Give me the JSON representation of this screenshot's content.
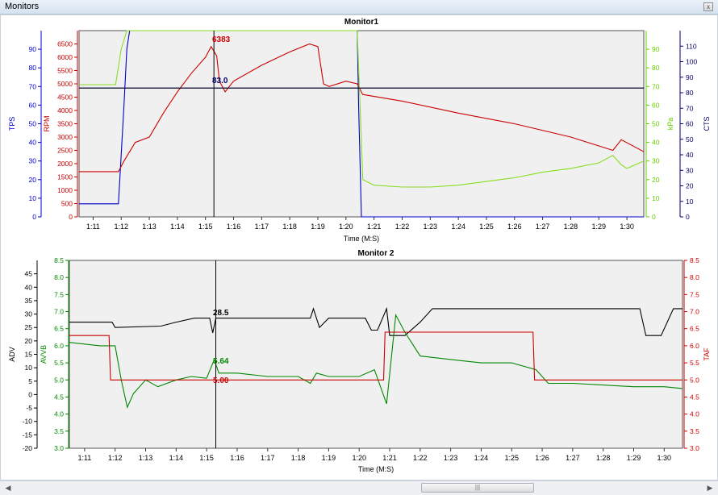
{
  "window": {
    "title": "Monitors",
    "close_glyph": "x"
  },
  "scrollbar": {
    "left_icon": "arrow-left-icon",
    "right_icon": "arrow-right-icon",
    "thumb_grip": "|||"
  },
  "chart_data": [
    {
      "type": "line",
      "title": "Monitor1",
      "xlabel": "Time (M:S)",
      "x_ticks": [
        "1:11",
        "1:12",
        "1:13",
        "1:14",
        "1:15",
        "1:16",
        "1:17",
        "1:18",
        "1:19",
        "1:20",
        "1:21",
        "1:22",
        "1:23",
        "1:24",
        "1:25",
        "1:26",
        "1:27",
        "1:28",
        "1:29",
        "1:30"
      ],
      "xlim": [
        "1:10.5",
        "1:30.6"
      ],
      "cursor": {
        "x": "1:15.3"
      },
      "axes": [
        {
          "id": "tps",
          "label": "TPS",
          "side": "left-outer",
          "color": "#0000cc",
          "range": [
            0,
            100
          ],
          "ticks": [
            0,
            10,
            20,
            30,
            40,
            50,
            60,
            70,
            80,
            90
          ]
        },
        {
          "id": "rpm",
          "label": "RPM",
          "side": "left-inner",
          "color": "#cc0000",
          "range": [
            0,
            7000
          ],
          "ticks": [
            0,
            500,
            1000,
            1500,
            2000,
            2500,
            3000,
            3500,
            4000,
            4500,
            5000,
            5500,
            6000,
            6500
          ]
        },
        {
          "id": "kpa",
          "label": "kPa",
          "side": "right-inner",
          "color": "#66cc00",
          "range": [
            0,
            100
          ],
          "ticks": [
            0,
            10,
            20,
            30,
            40,
            50,
            60,
            70,
            80,
            90
          ]
        },
        {
          "id": "cts",
          "label": "CTS",
          "side": "right-outer",
          "color": "#000066",
          "range": [
            0,
            120
          ],
          "ticks": [
            0,
            10,
            20,
            30,
            40,
            50,
            60,
            70,
            80,
            90,
            100,
            110
          ]
        }
      ],
      "series": [
        {
          "axis": "tps",
          "color": "#0000cc",
          "points": [
            [
              "1:10.5",
              7
            ],
            [
              "1:11.9",
              7
            ],
            [
              "1:12.1",
              60
            ],
            [
              "1:12.2",
              90
            ],
            [
              "1:12.3",
              100
            ],
            [
              "1:20.4",
              100
            ],
            [
              "1:20.45",
              60
            ],
            [
              "1:20.55",
              0
            ],
            [
              "1:30.6",
              0
            ]
          ]
        },
        {
          "axis": "rpm",
          "color": "#cc0000",
          "points": [
            [
              "1:10.5",
              1700
            ],
            [
              "1:11.9",
              1700
            ],
            [
              "1:12.1",
              2100
            ],
            [
              "1:12.5",
              2800
            ],
            [
              "1:13.0",
              3000
            ],
            [
              "1:13.5",
              3900
            ],
            [
              "1:14.0",
              4700
            ],
            [
              "1:14.5",
              5400
            ],
            [
              "1:15.0",
              6000
            ],
            [
              "1:15.2",
              6400
            ],
            [
              "1:15.4",
              6050
            ],
            [
              "1:15.5",
              5100
            ],
            [
              "1:15.7",
              4700
            ],
            [
              "1:16.0",
              5100
            ],
            [
              "1:17.0",
              5700
            ],
            [
              "1:18.0",
              6200
            ],
            [
              "1:18.7",
              6500
            ],
            [
              "1:19.0",
              6400
            ],
            [
              "1:19.2",
              5000
            ],
            [
              "1:19.4",
              4900
            ],
            [
              "1:20.0",
              5100
            ],
            [
              "1:20.4",
              5000
            ],
            [
              "1:20.6",
              4600
            ],
            [
              "1:22.0",
              4350
            ],
            [
              "1:24.0",
              3900
            ],
            [
              "1:26.0",
              3500
            ],
            [
              "1:28.0",
              3000
            ],
            [
              "1:29.5",
              2500
            ],
            [
              "1:29.8",
              2900
            ],
            [
              "1:30.6",
              2450
            ]
          ]
        },
        {
          "axis": "kpa",
          "color": "#88dd22",
          "points": [
            [
              "1:10.5",
              71
            ],
            [
              "1:11.8",
              71
            ],
            [
              "1:12.0",
              90
            ],
            [
              "1:12.2",
              100
            ],
            [
              "1:20.4",
              100
            ],
            [
              "1:20.5",
              60
            ],
            [
              "1:20.6",
              20
            ],
            [
              "1:21.0",
              17
            ],
            [
              "1:22.0",
              16
            ],
            [
              "1:23.0",
              16
            ],
            [
              "1:24.0",
              17
            ],
            [
              "1:25.0",
              19
            ],
            [
              "1:26.0",
              21
            ],
            [
              "1:27.0",
              24
            ],
            [
              "1:28.0",
              26
            ],
            [
              "1:29.0",
              29
            ],
            [
              "1:29.5",
              33
            ],
            [
              "1:29.8",
              28
            ],
            [
              "1:30.0",
              26
            ],
            [
              "1:30.6",
              30
            ]
          ]
        },
        {
          "axis": "cts",
          "color": "#000066",
          "points": [
            [
              "1:10.5",
              83
            ],
            [
              "1:30.6",
              83
            ]
          ]
        }
      ],
      "labels": [
        {
          "text": "6383",
          "color": "#cc0000"
        },
        {
          "text": "83.0",
          "color": "#000066"
        }
      ]
    },
    {
      "type": "line",
      "title": "Monitor 2",
      "xlabel": "Time (M:S)",
      "x_ticks": [
        "1:11",
        "1:12",
        "1:13",
        "1:14",
        "1:15",
        "1:16",
        "1:17",
        "1:18",
        "1:19",
        "1:20",
        "1:21",
        "1:22",
        "1:23",
        "1:24",
        "1:25",
        "1:26",
        "1:27",
        "1:28",
        "1:29",
        "1:30"
      ],
      "xlim": [
        "1:10.5",
        "1:30.6"
      ],
      "cursor": {
        "x": "1:15.3"
      },
      "axes": [
        {
          "id": "adv",
          "label": "ADV",
          "side": "left-outer",
          "color": "#000000",
          "range": [
            -20,
            50
          ],
          "ticks": [
            -20,
            -15,
            -10,
            -5,
            0,
            5,
            10,
            15,
            20,
            25,
            30,
            35,
            40,
            45
          ]
        },
        {
          "id": "avvb",
          "label": "AVVB",
          "side": "left-inner",
          "color": "#008800",
          "range": [
            3.0,
            8.5
          ],
          "ticks": [
            3.0,
            3.5,
            4.0,
            4.5,
            5.0,
            5.5,
            6.0,
            6.5,
            7.0,
            7.5,
            8.0,
            8.5
          ]
        },
        {
          "id": "taf",
          "label": "TAF",
          "side": "right",
          "color": "#cc0000",
          "range": [
            3.0,
            8.5
          ],
          "ticks": [
            3.0,
            3.5,
            4.0,
            4.5,
            5.0,
            5.5,
            6.0,
            6.5,
            7.0,
            7.5,
            8.0,
            8.5
          ]
        }
      ],
      "series": [
        {
          "axis": "adv",
          "color": "#000000",
          "points": [
            [
              "1:10.5",
              27
            ],
            [
              "1:11.9",
              27
            ],
            [
              "1:12.0",
              25
            ],
            [
              "1:13.5",
              25.5
            ],
            [
              "1:14.0",
              27
            ],
            [
              "1:14.6",
              28.5
            ],
            [
              "1:15.1",
              28.5
            ],
            [
              "1:15.2",
              23
            ],
            [
              "1:15.3",
              28.5
            ],
            [
              "1:18.4",
              28.5
            ],
            [
              "1:18.5",
              32
            ],
            [
              "1:18.7",
              25
            ],
            [
              "1:19.0",
              28.5
            ],
            [
              "1:20.2",
              28.5
            ],
            [
              "1:20.4",
              24
            ],
            [
              "1:20.6",
              24
            ],
            [
              "1:20.9",
              32
            ],
            [
              "1:21.0",
              22
            ],
            [
              "1:21.5",
              22
            ],
            [
              "1:22.0",
              27
            ],
            [
              "1:22.4",
              32
            ],
            [
              "1:29.2",
              32
            ],
            [
              "1:29.4",
              22
            ],
            [
              "1:29.9",
              22
            ],
            [
              "1:30.3",
              32
            ],
            [
              "1:30.6",
              32
            ]
          ]
        },
        {
          "axis": "avvb",
          "color": "#008800",
          "points": [
            [
              "1:10.5",
              6.1
            ],
            [
              "1:11.5",
              6.0
            ],
            [
              "1:12.0",
              6.0
            ],
            [
              "1:12.2",
              5.0
            ],
            [
              "1:12.4",
              4.2
            ],
            [
              "1:12.6",
              4.6
            ],
            [
              "1:13.0",
              5.0
            ],
            [
              "1:13.4",
              4.8
            ],
            [
              "1:14.0",
              5.0
            ],
            [
              "1:14.5",
              5.1
            ],
            [
              "1:15.0",
              5.05
            ],
            [
              "1:15.25",
              5.6
            ],
            [
              "1:15.4",
              5.2
            ],
            [
              "1:16.0",
              5.2
            ],
            [
              "1:17.0",
              5.1
            ],
            [
              "1:18.0",
              5.1
            ],
            [
              "1:18.4",
              4.9
            ],
            [
              "1:18.6",
              5.2
            ],
            [
              "1:19.0",
              5.1
            ],
            [
              "1:20.0",
              5.1
            ],
            [
              "1:20.5",
              5.3
            ],
            [
              "1:20.9",
              4.3
            ],
            [
              "1:21.2",
              6.9
            ],
            [
              "1:21.5",
              6.4
            ],
            [
              "1:22.0",
              5.7
            ],
            [
              "1:23.0",
              5.6
            ],
            [
              "1:24.0",
              5.5
            ],
            [
              "1:25.0",
              5.5
            ],
            [
              "1:25.8",
              5.3
            ],
            [
              "1:26.2",
              4.9
            ],
            [
              "1:27.0",
              4.9
            ],
            [
              "1:28.0",
              4.85
            ],
            [
              "1:29.0",
              4.8
            ],
            [
              "1:30.0",
              4.8
            ],
            [
              "1:30.6",
              4.75
            ]
          ]
        },
        {
          "axis": "taf",
          "color": "#cc0000",
          "points": [
            [
              "1:10.5",
              6.3
            ],
            [
              "1:11.8",
              6.3
            ],
            [
              "1:11.85",
              5.0
            ],
            [
              "1:20.8",
              5.0
            ],
            [
              "1:20.85",
              6.4
            ],
            [
              "1:25.7",
              6.4
            ],
            [
              "1:25.75",
              5.0
            ],
            [
              "1:30.6",
              5.0
            ]
          ]
        }
      ],
      "labels": [
        {
          "text": "28.5",
          "color": "#000000"
        },
        {
          "text": "5.64",
          "color": "#008800"
        },
        {
          "text": "5.00",
          "color": "#cc0000"
        }
      ]
    }
  ]
}
